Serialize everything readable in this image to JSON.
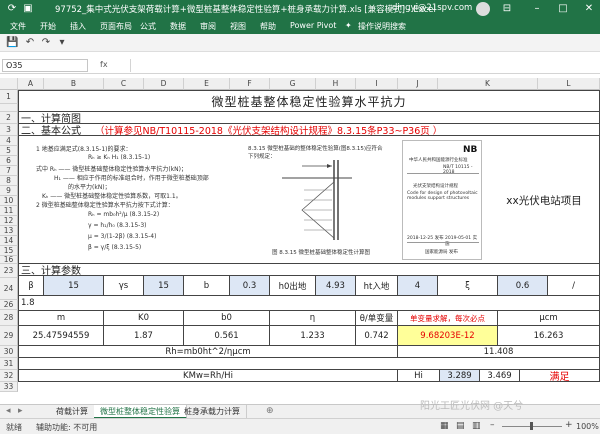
{
  "window": {
    "title": "97752_集中式光伏支架荷载计算+微型桩基整体稳定性验算+桩身承载力计算.xls [兼容模式] - Excel",
    "user": "dingyi@21spv.com"
  },
  "ribbon": {
    "tabs": [
      "文件",
      "开始",
      "插入",
      "页面布局",
      "公式",
      "数据",
      "审阅",
      "视图",
      "帮助",
      "Power Pivot",
      "操作说明搜索"
    ]
  },
  "formula_bar": {
    "name_box": "O35",
    "fx": "fx",
    "value": ""
  },
  "columns": [
    "A",
    "B",
    "C",
    "D",
    "E",
    "F",
    "G",
    "H",
    "I",
    "J",
    "K",
    "L"
  ],
  "rows": [
    "1",
    "2",
    "3",
    "4",
    "5",
    "6",
    "7",
    "8",
    "9",
    "10",
    "11",
    "12",
    "13",
    "14",
    "15",
    "16",
    "17",
    "18",
    "19",
    "20",
    "21",
    "22",
    "23",
    "24",
    "25",
    "26",
    "27",
    "28",
    "29",
    "30",
    "31",
    "32",
    "33",
    "34",
    "35"
  ],
  "sheet": {
    "title": "微型桩基整体稳定性验算水平抗力",
    "sec1": "一、计算简图",
    "sec2_label": "二、基本公式",
    "sec2_ref": "（计算参见NB/T10115-2018《光伏支架结构设计规程》8.3.15条P33~P36页 ）",
    "sec3": "三、计算参数",
    "project": "xx光伏电站项目",
    "doc_left": {
      "l1": "1  地基应满足式(8.3.15-1)的要求：",
      "l2": "Rₕ ≥ Kₕ H₁          (8.3.15-1)",
      "l3": "式中 Rₕ —— 微型桩基础整体稳定性验算水平抗力(kN)；",
      "l4": "H₁ —— 相应于作用的标准组合时，作用于微型桩基础顶部",
      "l5": "的水平力(kN)；",
      "l6": "Kₕ —— 微型桩基础整体稳定性验算系数，可取1.1。",
      "l7": "2  微型桩基础整体稳定性验算水平抗力按下式计算：",
      "l8": "Rₕ = mb₀h²/μ          (8.3.15-2)",
      "l9": "γ = h₁/h₀          (8.3.15-3)",
      "l10": "μ = 3/(1-2β)          (8.3.15-4)",
      "l11": "β = γ/ξ          (8.3.15-5)"
    },
    "doc_mid": {
      "l1": "8.3.15  微型桩基础的整体稳定性验算(图8.3.15)应符合下列规定：",
      "caption": "图 8.3.15  微型桩基础整体稳定性计算图"
    },
    "doc_right": {
      "code": "NB",
      "org": "中华人民共和国能源行业标准",
      "std": "NB/T 10115 - 2018",
      "name": "光伏支架结构设计规程",
      "en": "Code for design of photovoltaic modules support structures",
      "d1": "2018-12-25 发布",
      "d2": "2019-05-01 实施",
      "issuer": "国家能源局 发布"
    },
    "params_row": {
      "c1": "β",
      "c2": "15",
      "c3": "γs",
      "c4": "15",
      "c5": "b",
      "c6": "0.3",
      "c7": "h0出地",
      "c8": "4.93",
      "c9": "ht入地",
      "c10": "4",
      "c11": "ξ",
      "c12": "0.6",
      "c13": "/"
    },
    "row26": "1.8",
    "head_row": {
      "m": "m",
      "k0": "K0",
      "b0": "b0",
      "eta": "η",
      "theta": "θ/单变量",
      "note": "单变量求解，每次必点",
      "mu": "μcm"
    },
    "value_row": {
      "m": "25.47594559",
      "k0": "1.87",
      "b0": "0.561",
      "eta": "1.233",
      "theta": "0.742",
      "x": "9.68203E-12",
      "mu": "16.263"
    },
    "rh_formula": "Rh=mb0ht^2/ημcm",
    "rh_value": "11.408",
    "kmw_formula": "KMw=Rh/Hi",
    "hi_label": "Hi",
    "hi_value": "3.289",
    "kmw_value": "3.469",
    "result": "满足"
  },
  "sheet_tabs": [
    "荷载计算",
    "微型桩整体稳定性验算",
    "桩身承载力计算"
  ],
  "active_tab": 1,
  "status": {
    "ready": "就绪",
    "accessibility": "辅助功能: 不可用",
    "zoom": "100%"
  },
  "watermark": "阳光工匠光伏网 @天兮",
  "colors": {
    "excel_green": "#217346",
    "red_text": "#e60000",
    "highlight": "#ffff99"
  }
}
